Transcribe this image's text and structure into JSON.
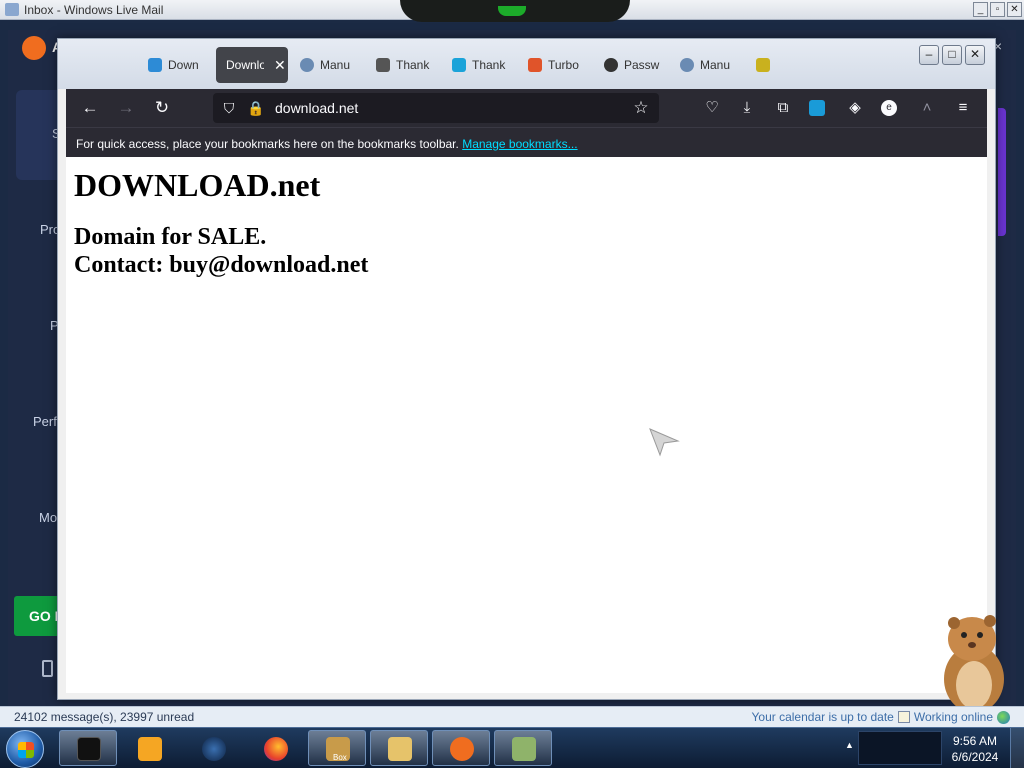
{
  "wlm": {
    "title": "Inbox - Windows Live Mail",
    "status_left": "24102 message(s), 23997 unread",
    "status_calendar": "Your calendar is up to date",
    "status_online": "Working online"
  },
  "avast": {
    "logo_text": "A",
    "side_labels": [
      "S",
      "Pro",
      "P",
      "Perf",
      "Mo"
    ],
    "go_button": "GO F",
    "close": "×"
  },
  "firefox": {
    "tabs": [
      {
        "label": "Down",
        "favicon_color": "#2d8bd6"
      },
      {
        "label": "Downlo",
        "favicon_color": "",
        "active": true
      },
      {
        "label": "Manu",
        "favicon_color": "#6a8bb3"
      },
      {
        "label": "Thank",
        "favicon_color": "#555555"
      },
      {
        "label": "Thank",
        "favicon_color": "#1aa3d9"
      },
      {
        "label": "Turbo",
        "favicon_color": "#e0542a"
      },
      {
        "label": "Passw",
        "favicon_color": "#333333"
      },
      {
        "label": "Manu",
        "favicon_color": "#6a8bb3"
      },
      {
        "label": "",
        "favicon_color": "#c9b11e"
      }
    ],
    "url": "download.net",
    "bookmarks_hint": "For quick access, place your bookmarks here on the bookmarks toolbar.",
    "manage_bookmarks": "Manage bookmarks..."
  },
  "page": {
    "heading": "DOWNLOAD.net",
    "line1": "Domain for SALE.",
    "line2": "Contact: buy@download.net"
  },
  "taskbar": {
    "time": "9:56 AM",
    "date": "6/6/2024",
    "box_label": "Box"
  },
  "colors": {
    "firefox_dark": "#2b2a33",
    "link": "#00ddff",
    "avast_orange": "#f06d1f",
    "go_green": "#0e9a3e"
  }
}
